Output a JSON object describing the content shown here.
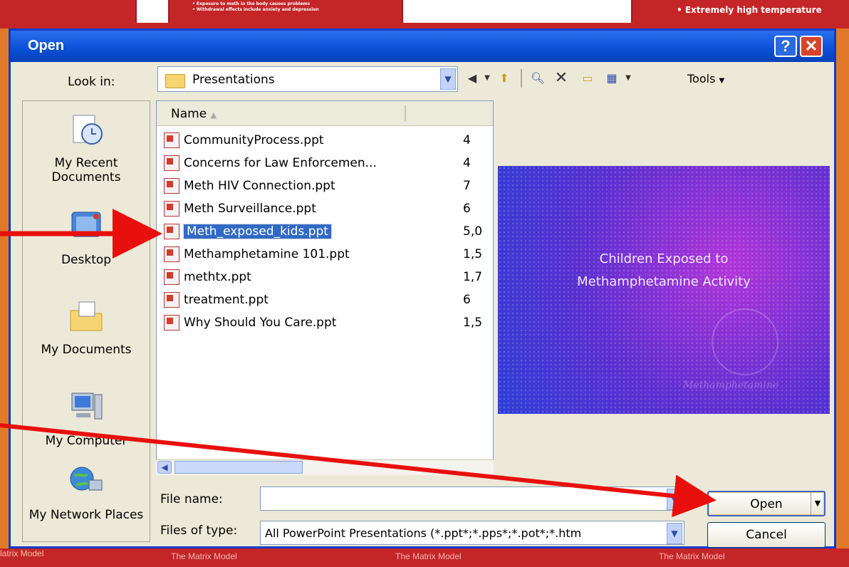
{
  "background": {
    "top_left_text": "• Exposure to meth in the body causes problems\n• Withdrawal effects include anxiety and depression",
    "top_right_text": "• Extremely high temperature",
    "bottom_labels": [
      "The Matrix Model",
      "The Matrix Model",
      "The Matrix Model"
    ],
    "bottom_left_label": "latrix Model"
  },
  "dialog": {
    "title": "Open",
    "help_label": "?",
    "close_label": "✕"
  },
  "lookin": {
    "label": "Look in:",
    "value": "Presentations"
  },
  "toolbar": {
    "tools_label": "Tools"
  },
  "places": [
    {
      "label": "My Recent Documents",
      "icon": "recent-documents-icon"
    },
    {
      "label": "Desktop",
      "icon": "desktop-icon"
    },
    {
      "label": "My Documents",
      "icon": "my-documents-icon"
    },
    {
      "label": "My Computer",
      "icon": "my-computer-icon"
    },
    {
      "label": "My Network Places",
      "icon": "network-places-icon"
    }
  ],
  "list": {
    "header_name": "Name",
    "files": [
      {
        "name": "CommunityProcess.ppt",
        "size": "4"
      },
      {
        "name": "Concerns for Law Enforcemen...",
        "size": "4"
      },
      {
        "name": "Meth HIV Connection.ppt",
        "size": "7"
      },
      {
        "name": "Meth Surveillance.ppt",
        "size": "6"
      },
      {
        "name": "Meth_exposed_kids.ppt",
        "size": "5,0",
        "selected": true
      },
      {
        "name": "Methamphetamine 101.ppt",
        "size": "1,5"
      },
      {
        "name": "methtx.ppt",
        "size": "1,7"
      },
      {
        "name": "treatment.ppt",
        "size": "6"
      },
      {
        "name": "Why Should You Care.ppt",
        "size": "1,5"
      }
    ]
  },
  "preview": {
    "line1": "Children Exposed to",
    "line2": "Methamphetamine Activity",
    "signature": "Methamphetamine"
  },
  "filename": {
    "label": "File name:",
    "value": ""
  },
  "filetype": {
    "label": "Files of type:",
    "value": "All PowerPoint Presentations (*.ppt*;*.pps*;*.pot*;*.htm"
  },
  "buttons": {
    "open": "Open",
    "cancel": "Cancel"
  }
}
